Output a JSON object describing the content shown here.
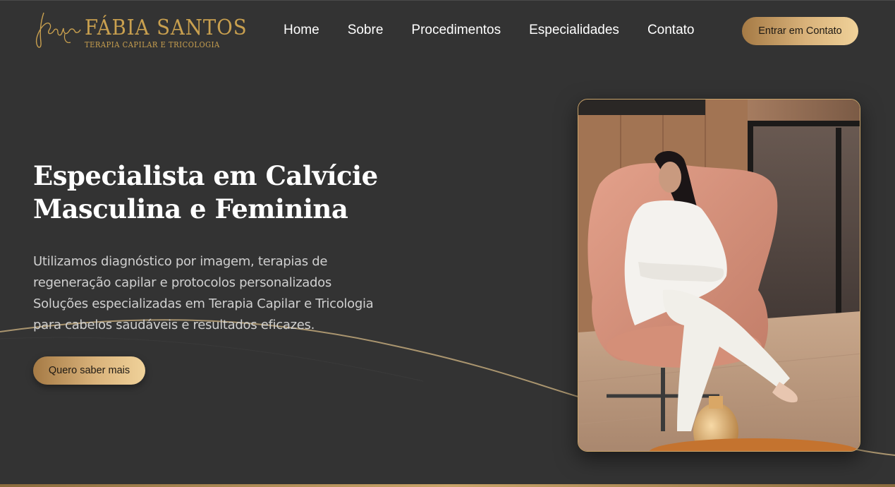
{
  "brand": {
    "name": "FÁBIA SANTOS",
    "tagline": "TERAPIA CAPILAR E TRICOLOGIA",
    "accent_color": "#c9a04f"
  },
  "nav": {
    "items": [
      {
        "label": "Home"
      },
      {
        "label": "Sobre"
      },
      {
        "label": "Procedimentos"
      },
      {
        "label": "Especialidades"
      },
      {
        "label": "Contato"
      }
    ],
    "cta_label": "Entrar em Contato"
  },
  "hero": {
    "title_line1": "Especialista em Calvície",
    "title_line2": "Masculina e Feminina",
    "description_lines": [
      "Utilizamos diagnóstico por imagem, terapias de",
      "regeneração capilar e protocolos personalizados",
      "Soluções especializadas em Terapia Capilar e Tricologia",
      "para cabelos saudáveis e resultados eficazes."
    ],
    "cta_label": "Quero saber mais"
  },
  "colors": {
    "background": "#333333",
    "button_gradient_start": "#a57a45",
    "button_gradient_end": "#f0d29a"
  }
}
